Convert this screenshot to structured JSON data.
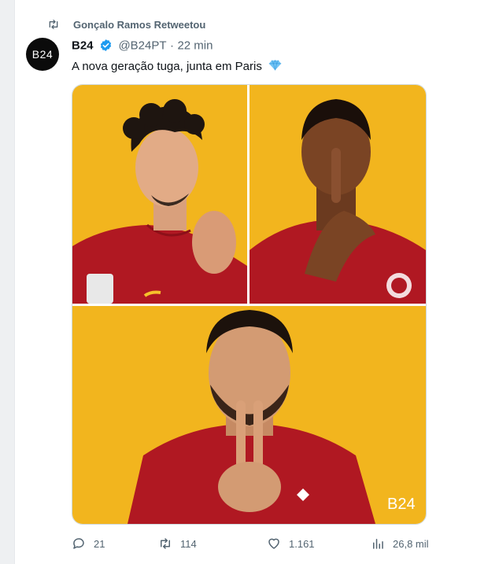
{
  "retweet": {
    "label": "Gonçalo Ramos Retweetou",
    "icon": "retweet-icon"
  },
  "author": {
    "avatar_text": "B24",
    "name": "B24",
    "handle": "@B24PT",
    "separator": "·",
    "time": "22 min",
    "verified": true
  },
  "tweet": {
    "text": "A nova geração tuga, junta em Paris",
    "emoji": "gem-icon"
  },
  "media": {
    "background_color": "#f2b51e",
    "shirt_color": "#b01822",
    "watermark": "B24",
    "photos": [
      "player-photo-1",
      "player-photo-2",
      "player-photo-3"
    ]
  },
  "actions": {
    "replies": "21",
    "retweets": "114",
    "likes": "1.161",
    "views": "26,8 mil"
  },
  "colors": {
    "secondary_text": "#536471",
    "primary_text": "#0f1419",
    "verified": "#1d9bf0"
  }
}
